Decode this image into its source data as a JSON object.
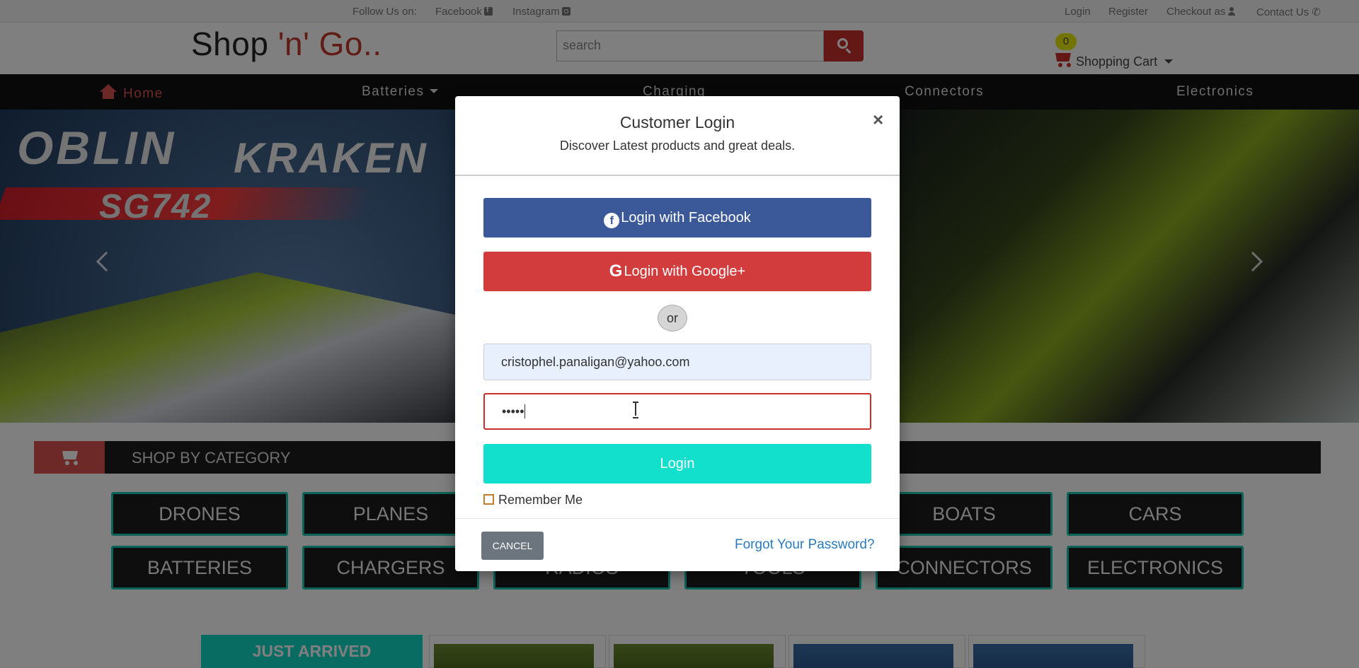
{
  "topbar": {
    "follow_label": "Follow Us on:",
    "facebook": "Facebook",
    "instagram": "Instagram",
    "login": "Login",
    "register": "Register",
    "checkout": "Checkout as",
    "contact": "Contact Us"
  },
  "header": {
    "logo_main": "Shop ",
    "logo_accent": "'n' Go..",
    "search_placeholder": "search",
    "cart_count": "0",
    "cart_label": "Shopping Cart"
  },
  "nav": {
    "home": "Home",
    "batteries": "Batteries",
    "charging": "Charging",
    "connectors": "Connectors",
    "electronics": "Electronics"
  },
  "banner": {
    "brand": "OBLIN",
    "model": "KRAKEN",
    "code": "SG742"
  },
  "category": {
    "heading": "SHOP BY CATEGORY",
    "row1": [
      "DRONES",
      "PLANES",
      "",
      "",
      "BOATS",
      "CARS"
    ],
    "row2": [
      "BATTERIES",
      "CHARGERS",
      "RADIOS",
      "TOOLS",
      "CONNECTORS",
      "ELECTRONICS"
    ]
  },
  "just_arrived": "JUST ARRIVED",
  "modal": {
    "title": "Customer Login",
    "subtitle": "Discover Latest products and great deals.",
    "close": "×",
    "facebook_btn": "Login with Facebook",
    "google_btn": "Login with Google+",
    "or": "or",
    "email_value": "cristophel.panaligan@yahoo.com",
    "password_value": "•••••",
    "login_btn": "Login",
    "remember": "Remember Me",
    "cancel": "CANCEL",
    "forgot": "Forgot Your Password?"
  },
  "colors": {
    "accent_red": "#c9302c",
    "teal": "#12dfcc",
    "facebook": "#3b5998",
    "google": "#d23c3c"
  }
}
